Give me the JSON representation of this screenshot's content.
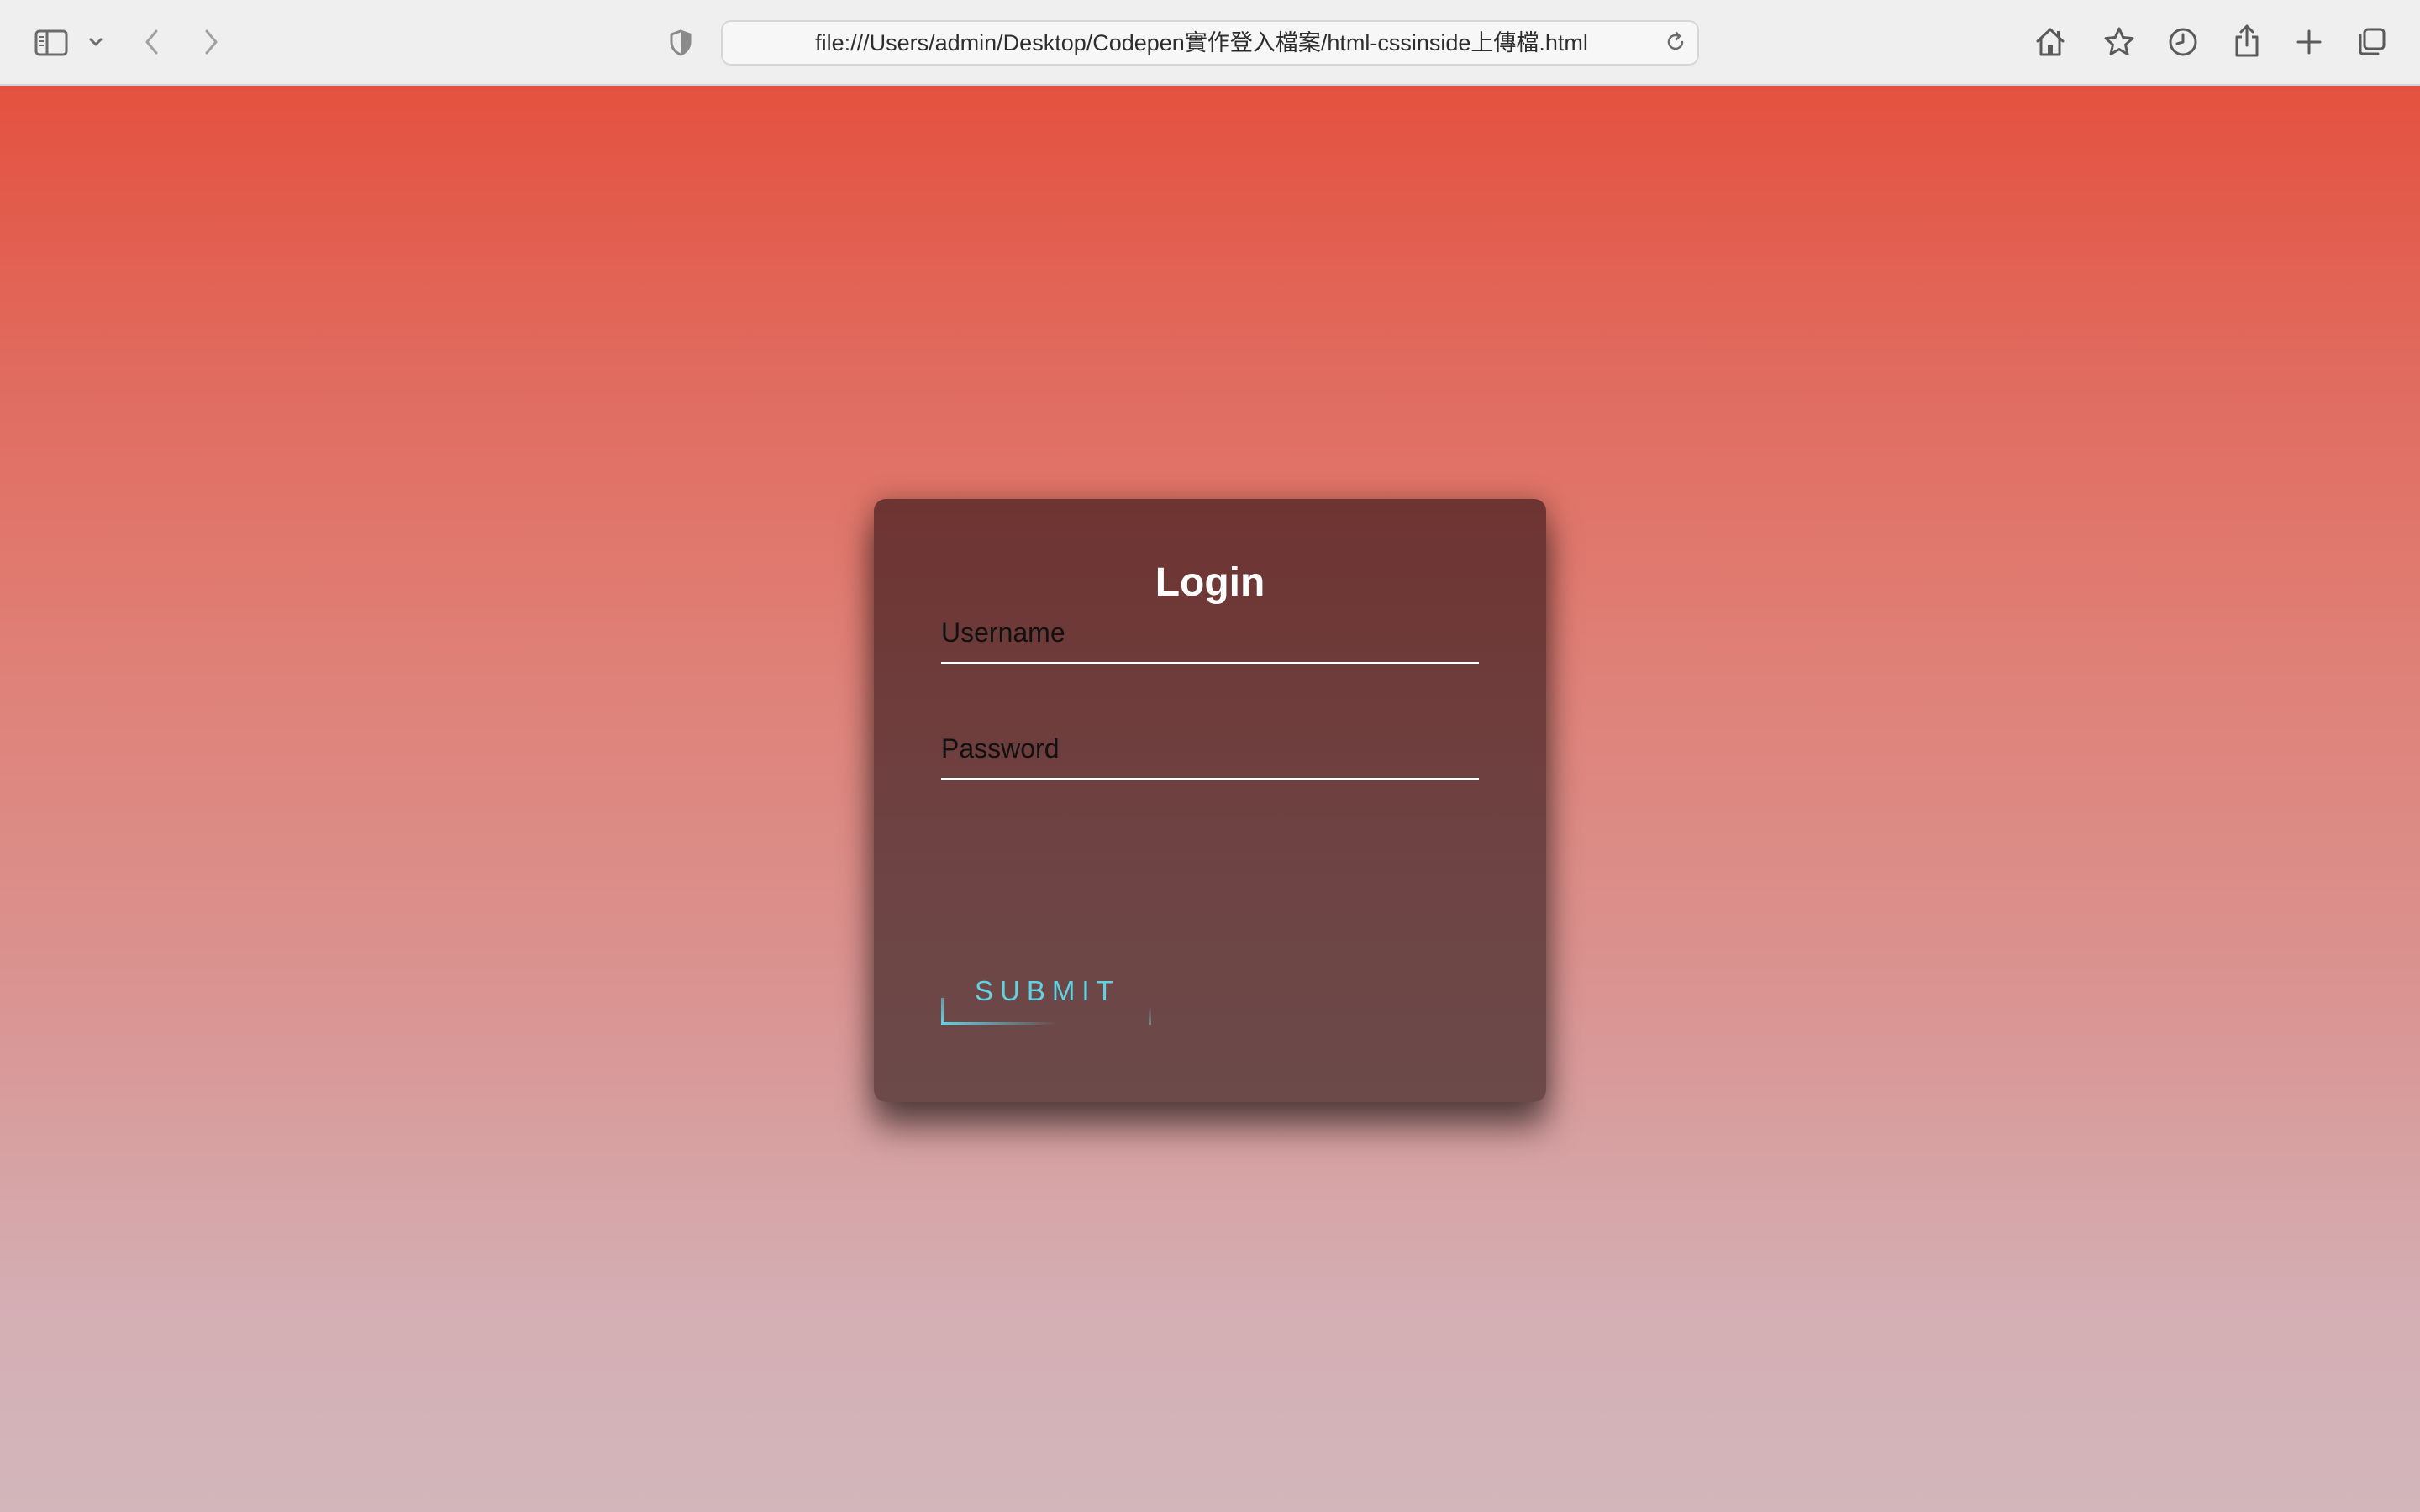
{
  "browser": {
    "url": "file:///Users/admin/Desktop/Codepen實作登入檔案/html-cssinside上傳檔.html",
    "icons": {
      "sidebar": "sidebar-icon",
      "sidebar_menu": "chevron-down-icon",
      "back": "chevron-left-icon",
      "forward": "chevron-right-icon",
      "privacy": "shield-icon",
      "reload": "reload-icon",
      "home": "home-icon",
      "bookmark": "star-icon",
      "history": "clock-icon",
      "share": "share-icon",
      "new_tab": "plus-icon",
      "tabs": "tabs-icon"
    }
  },
  "login": {
    "title": "Login",
    "username_placeholder": "Username",
    "password_placeholder": "Password",
    "submit_label": "SUBMIT"
  },
  "colors": {
    "background_top": "#e4513f",
    "background_bottom": "#d2b6bb",
    "card": "#6e3f3e",
    "accent": "#5fd3e4"
  }
}
